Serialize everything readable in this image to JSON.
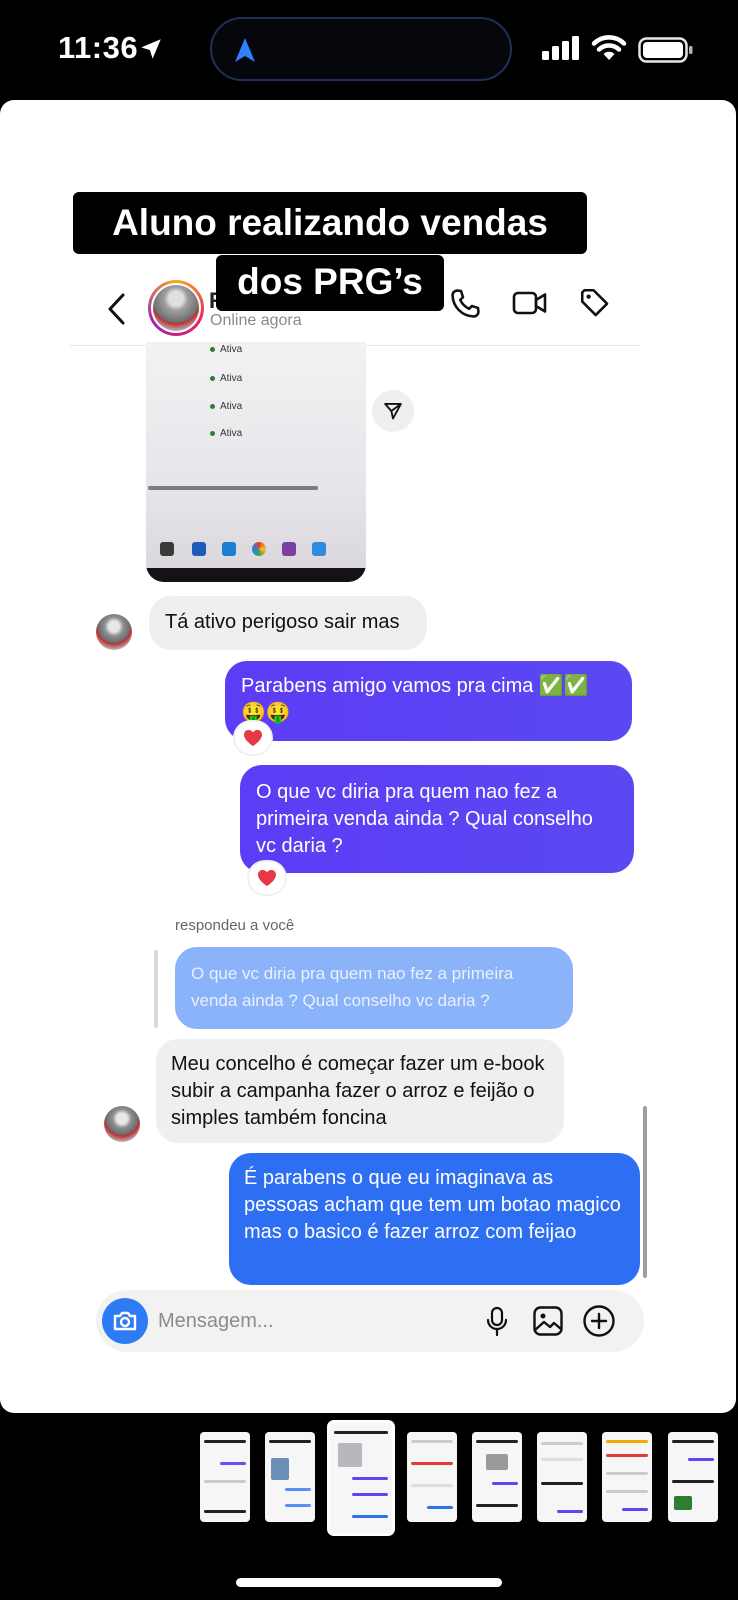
{
  "status_bar": {
    "time": "11:36",
    "icons": [
      "location-arrow-icon",
      "cellular-signal-icon",
      "wifi-icon",
      "battery-icon"
    ]
  },
  "caption": {
    "line1": "Aluno realizando vendas",
    "line2": "dos PRG’s"
  },
  "chat_header": {
    "contact_name_partial": "R",
    "status": "Online agora",
    "icons": [
      "back-icon",
      "phone-icon",
      "video-icon",
      "tag-icon"
    ]
  },
  "shared_photo": {
    "rows": [
      "Ativa",
      "Ativa",
      "Ativa",
      "Ativa"
    ]
  },
  "messages": [
    {
      "from": "contact",
      "text": "Tá ativo perigoso sair mas"
    },
    {
      "from": "me",
      "text": "Parabens amigo vamos pra cima ✅✅ 🤑🤑",
      "reaction": "❤️"
    },
    {
      "from": "me",
      "text": "O que vc diria pra quem nao fez a primeira venda ainda ? Qual conselho vc daria ?",
      "reaction": "❤️"
    },
    {
      "from": "contact",
      "replied_label": "respondeu a você",
      "quoted": "O que vc diria pra quem nao fez a primeira venda ainda ? Qual conselho vc daria ?",
      "text": "Meu concelho é começar fazer um e-book  subir a campanha fazer o arroz e feijão o simples também foncina"
    },
    {
      "from": "me",
      "text": "É parabens o que eu imaginava as pessoas acham que tem um botao magico mas o basico é fazer arroz com feijao"
    }
  ],
  "composer": {
    "placeholder": "Mensagem...",
    "icons": [
      "camera-icon",
      "microphone-icon",
      "gallery-icon",
      "plus-icon"
    ]
  },
  "thumbnails": {
    "count": 8,
    "active_index": 2
  },
  "colors": {
    "sent_purple": "#5a48f2",
    "sent_blue": "#2d6ef3",
    "quoted_blue": "#8ab3fa",
    "received_gray": "#efefef",
    "camera_blue": "#2d7cf6"
  }
}
